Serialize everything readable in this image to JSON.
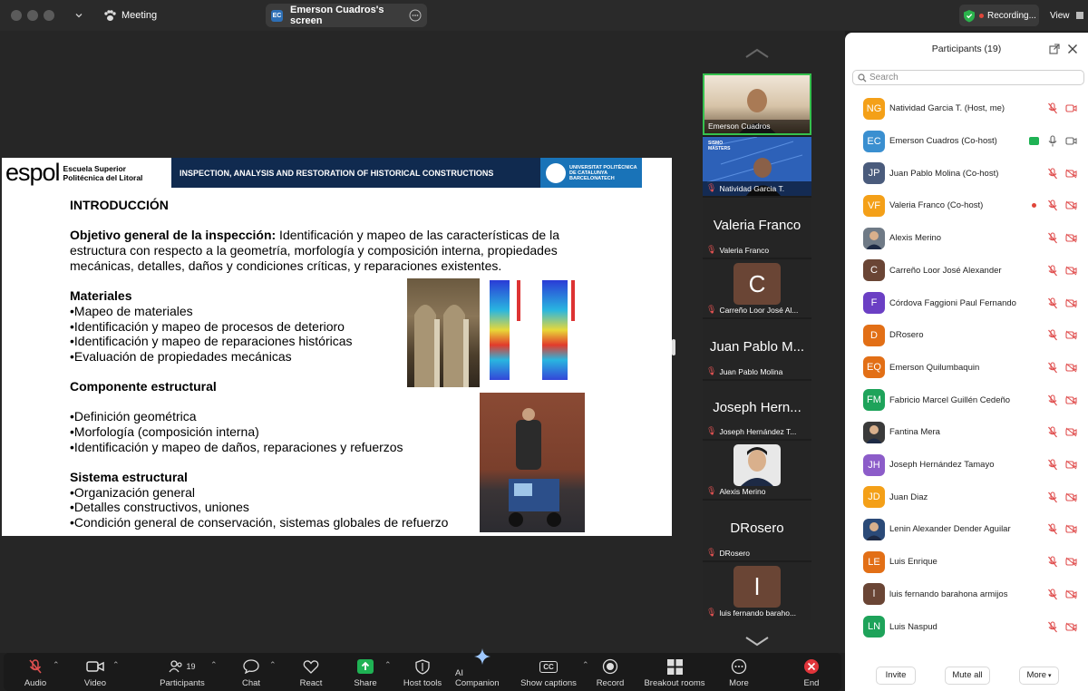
{
  "titlebar": {
    "meeting_label": "Meeting",
    "screen_tab_badge": "EC",
    "screen_tab_label": "Emerson Cuadros's screen",
    "recording_label": "Recording...",
    "view_label": "View"
  },
  "slide": {
    "logo_word": "espol",
    "logo_sub1": "Escuela Superior",
    "logo_sub2": "Politécnica del Litoral",
    "banner_text": "INSPECTION, ANALYSIS AND RESTORATION OF HISTORICAL CONSTRUCTIONS",
    "upc_line1": "UNIVERSITAT POLITÈCNICA",
    "upc_line2": "DE CATALUNYA",
    "upc_line3": "BARCELONATECH",
    "heading": "INTRODUCCIÓN",
    "objective_bold": "Objetivo general de la inspección:",
    "objective_l1": " Identificación y mapeo de las características de la",
    "objective_l2": "estructura con respecto a la geometría, morfología y composición interna, propiedades",
    "objective_l3": "mecánicas, detalles, daños y condiciones críticas, y reparaciones existentes.",
    "materiales_title": "Materiales",
    "materiales": [
      "•Mapeo de materiales",
      "•Identificación y mapeo de procesos de deterioro",
      "•Identificación y mapeo de reparaciones históricas",
      "•Evaluación de propiedades mecánicas"
    ],
    "componente_title": "Componente estructural",
    "componente": [
      "•Definición geométrica",
      "•Morfología (composición interna)",
      "•Identificación y mapeo de daños, reparaciones y refuerzos"
    ],
    "sistema_title": "Sistema estructural",
    "sistema": [
      "•Organización general",
      "•Detalles constructivos, uniones",
      "•Condición general de conservación, sistemas globales de refuerzo"
    ]
  },
  "video_strip": {
    "tiles": [
      {
        "name": "Emerson Cuadros"
      },
      {
        "name": "Natividad Garcia T.",
        "banner": "SISMO MASTERS"
      },
      {
        "big": "Valeria Franco",
        "name": "Valeria Franco"
      },
      {
        "initial": "C",
        "name": "Carreño Loor José Al..."
      },
      {
        "big": "Juan Pablo M...",
        "name": "Juan Pablo Molina"
      },
      {
        "big": "Joseph Hern...",
        "name": "Joseph Hernández T..."
      },
      {
        "name": "Alexis Merino"
      },
      {
        "big": "DRosero",
        "name": "DRosero"
      },
      {
        "initial": "l",
        "name": "luis fernando baraho..."
      }
    ]
  },
  "toolbar": {
    "audio": "Audio",
    "video": "Video",
    "participants": "Participants",
    "participants_count": "19",
    "chat": "Chat",
    "react": "React",
    "share": "Share",
    "host_tools": "Host tools",
    "ai_companion": "AI Companion",
    "show_captions": "Show captions",
    "cc_glyph": "CC",
    "record": "Record",
    "breakout_rooms": "Breakout rooms",
    "more": "More",
    "end": "End"
  },
  "panel": {
    "title": "Participants (19)",
    "search_placeholder": "Search",
    "invite": "Invite",
    "mute_all": "Mute all",
    "more": "More",
    "participants": [
      {
        "initials": "NG",
        "name": "Natividad Garcia T. (Host, me)",
        "color": "#f4a018"
      },
      {
        "initials": "EC",
        "name": "Emerson Cuadros (Co-host)",
        "color": "#3a8fd0"
      },
      {
        "initials": "JP",
        "name": "Juan Pablo Molina (Co-host)",
        "color": "#4a5b7c"
      },
      {
        "initials": "VF",
        "name": "Valeria Franco (Co-host)",
        "color": "#f4a018"
      },
      {
        "initials": "",
        "name": "Alexis Merino",
        "color": "#6f7a86"
      },
      {
        "initials": "C",
        "name": "Carreño Loor José Alexander",
        "color": "#6a4535"
      },
      {
        "initials": "F",
        "name": "Córdova Faggioni Paul Fernando",
        "color": "#6b3fc4"
      },
      {
        "initials": "D",
        "name": "DRosero",
        "color": "#e26f16"
      },
      {
        "initials": "EQ",
        "name": "Emerson Quilumbaquin",
        "color": "#e26f16"
      },
      {
        "initials": "FM",
        "name": "Fabricio Marcel Guillén Cedeño",
        "color": "#1ea35a"
      },
      {
        "initials": "",
        "name": "Fantina Mera",
        "color": "#3a3a3a"
      },
      {
        "initials": "JH",
        "name": "Joseph Hernández Tamayo",
        "color": "#8c5cc9"
      },
      {
        "initials": "JD",
        "name": "Juan Diaz",
        "color": "#f4a018"
      },
      {
        "initials": "",
        "name": "Lenin Alexander Dender Aguilar",
        "color": "#2b4a78"
      },
      {
        "initials": "LE",
        "name": "Luis Enrique",
        "color": "#e26f16"
      },
      {
        "initials": "l",
        "name": "luis fernando barahona armijos",
        "color": "#6a4535"
      },
      {
        "initials": "LN",
        "name": "Luis Naspud",
        "color": "#1ea35a"
      }
    ]
  }
}
